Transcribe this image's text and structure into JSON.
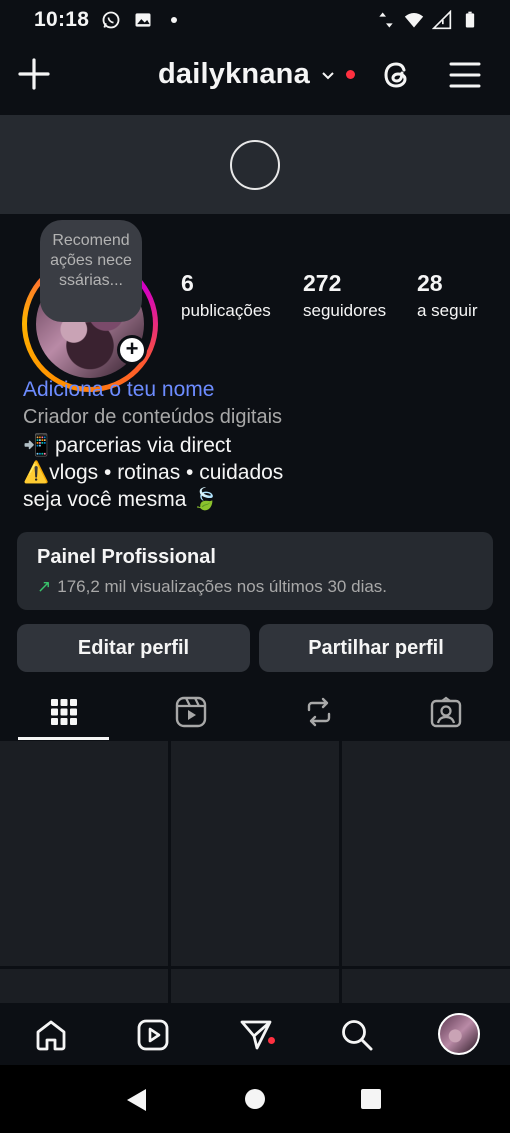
{
  "status_bar": {
    "time": "10:18"
  },
  "header": {
    "username": "dailyknana",
    "username_dropdown_icon": "chevron-down-icon"
  },
  "profile": {
    "note_text": "Recomendações necessárias...",
    "stats": [
      {
        "number": "6",
        "label": "publicações"
      },
      {
        "number": "272",
        "label": "seguidores"
      },
      {
        "number": "28",
        "label": "a seguir"
      }
    ],
    "bio": {
      "add_name_link": "Adiciona o teu nome",
      "category": "Criador de conteúdos digitais",
      "lines": [
        "📲 parcerias via direct",
        "⚠️vlogs • rotinas • cuidados",
        "seja você mesma 🍃"
      ]
    }
  },
  "dashboard": {
    "title": "Painel Profissional",
    "subtitle": "176,2 mil visualizações nos últimos 30 dias.",
    "trend_color": "#39c26b"
  },
  "buttons": {
    "edit": "Editar perfil",
    "share": "Partilhar perfil"
  },
  "tabs": [
    {
      "name": "grid",
      "icon": "grid-icon",
      "active": true
    },
    {
      "name": "reels",
      "icon": "reels-icon"
    },
    {
      "name": "reposts",
      "icon": "repost-icon"
    },
    {
      "name": "tagged",
      "icon": "tagged-icon"
    }
  ],
  "bottom_nav": [
    "home-icon",
    "reels-icon",
    "messages-icon",
    "search-icon",
    "profile-avatar"
  ],
  "colors": {
    "accent_link": "#6d8cff",
    "notification": "#ff3040",
    "background": "#0c0f14"
  }
}
